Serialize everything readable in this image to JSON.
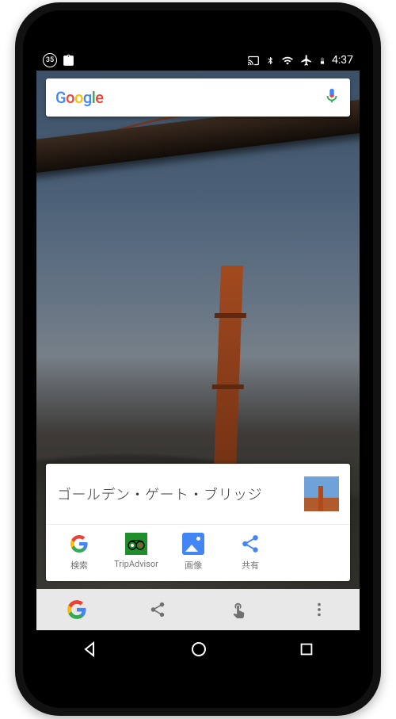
{
  "status": {
    "badge": "35",
    "time": "4:37"
  },
  "search": {
    "brand": "Google"
  },
  "card": {
    "title": "ゴールデン・ゲート・ブリッジ",
    "actions": [
      {
        "label": "検索",
        "icon": "google-g-icon"
      },
      {
        "label": "TripAdvisor",
        "icon": "tripadvisor-icon"
      },
      {
        "label": "画像",
        "icon": "pictures-icon"
      },
      {
        "label": "共有",
        "icon": "share-icon"
      }
    ]
  }
}
